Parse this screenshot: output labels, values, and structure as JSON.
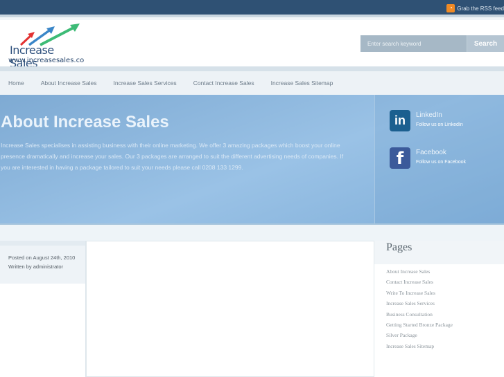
{
  "topbar": {
    "rss_label": "Grab the RSS feed",
    "rss_icon": "rss-icon"
  },
  "logo": {
    "title": "Increase Sales",
    "url": "www.increasesales.co"
  },
  "search": {
    "placeholder": "Enter search keyword",
    "button": "Search"
  },
  "nav": [
    "Home",
    "About Increase Sales",
    "Increase Sales Services",
    "Contact Increase Sales",
    "Increase Sales Sitemap"
  ],
  "hero": {
    "title": "About Increase Sales",
    "text": "Increase Sales specialises in assisting business with their online marketing. We offer 3 amazing packages which boost your online presence dramatically and increase your sales. Our 3 packages are arranged to suit the different advertising needs of companies. If you are interested in having a package tailored to suit your needs please call 0208 133 1299."
  },
  "social": [
    {
      "name": "LinkedIn",
      "sub": "Follow us on LinkedIn",
      "glyph": "in",
      "color": "#1b5f8f"
    },
    {
      "name": "Facebook",
      "sub": "Follow us on Facebook",
      "glyph": "f",
      "color": "#3b5a9a"
    }
  ],
  "meta": {
    "posted": "Posted on August 24th, 2010",
    "author": "Written by administrator"
  },
  "sidebar": {
    "title": "Pages",
    "items": [
      "About Increase Sales",
      "Contact Increase Sales",
      "Write To Increase Sales",
      "Increase Sales Services",
      "Business Consultation",
      "Getting Started Bronze Package",
      "Silver Package",
      "Increase Sales Sitemap"
    ]
  }
}
